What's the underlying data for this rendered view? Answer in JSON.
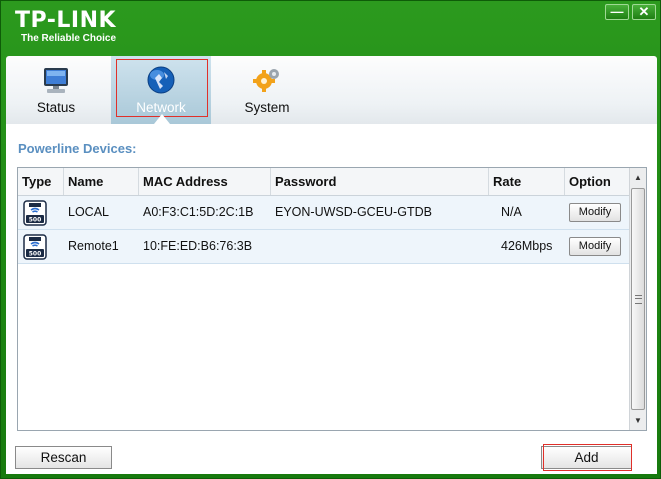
{
  "header": {
    "brand": "TP-LINK",
    "tagline": "The Reliable Choice",
    "minimize_icon": "minimize-icon",
    "close_icon": "close-icon"
  },
  "tabs": [
    {
      "label": "Status",
      "icon": "monitor-icon",
      "active": false
    },
    {
      "label": "Network",
      "icon": "globe-icon",
      "active": true
    },
    {
      "label": "System",
      "icon": "gears-icon",
      "active": false
    }
  ],
  "main": {
    "section_title": "Powerline Devices:",
    "columns": [
      "Type",
      "Name",
      "MAC Address",
      "Password",
      "Rate",
      "Option"
    ],
    "devices": [
      {
        "type_icon": "powerline-adapter-icon",
        "name": "LOCAL",
        "mac": "A0:F3:C1:5D:2C:1B",
        "password": "EYON-UWSD-GCEU-GTDB",
        "rate": "N/A",
        "option": "Modify"
      },
      {
        "type_icon": "powerline-adapter-icon",
        "name": "Remote1",
        "mac": "10:FE:ED:B6:76:3B",
        "password": "",
        "rate": "426Mbps",
        "option": "Modify"
      }
    ]
  },
  "footer": {
    "rescan_label": "Rescan",
    "add_label": "Add"
  },
  "colors": {
    "brand_green": "#1f8a14",
    "section_title": "#5a8fc0",
    "selection_frame": "#e0302a"
  }
}
